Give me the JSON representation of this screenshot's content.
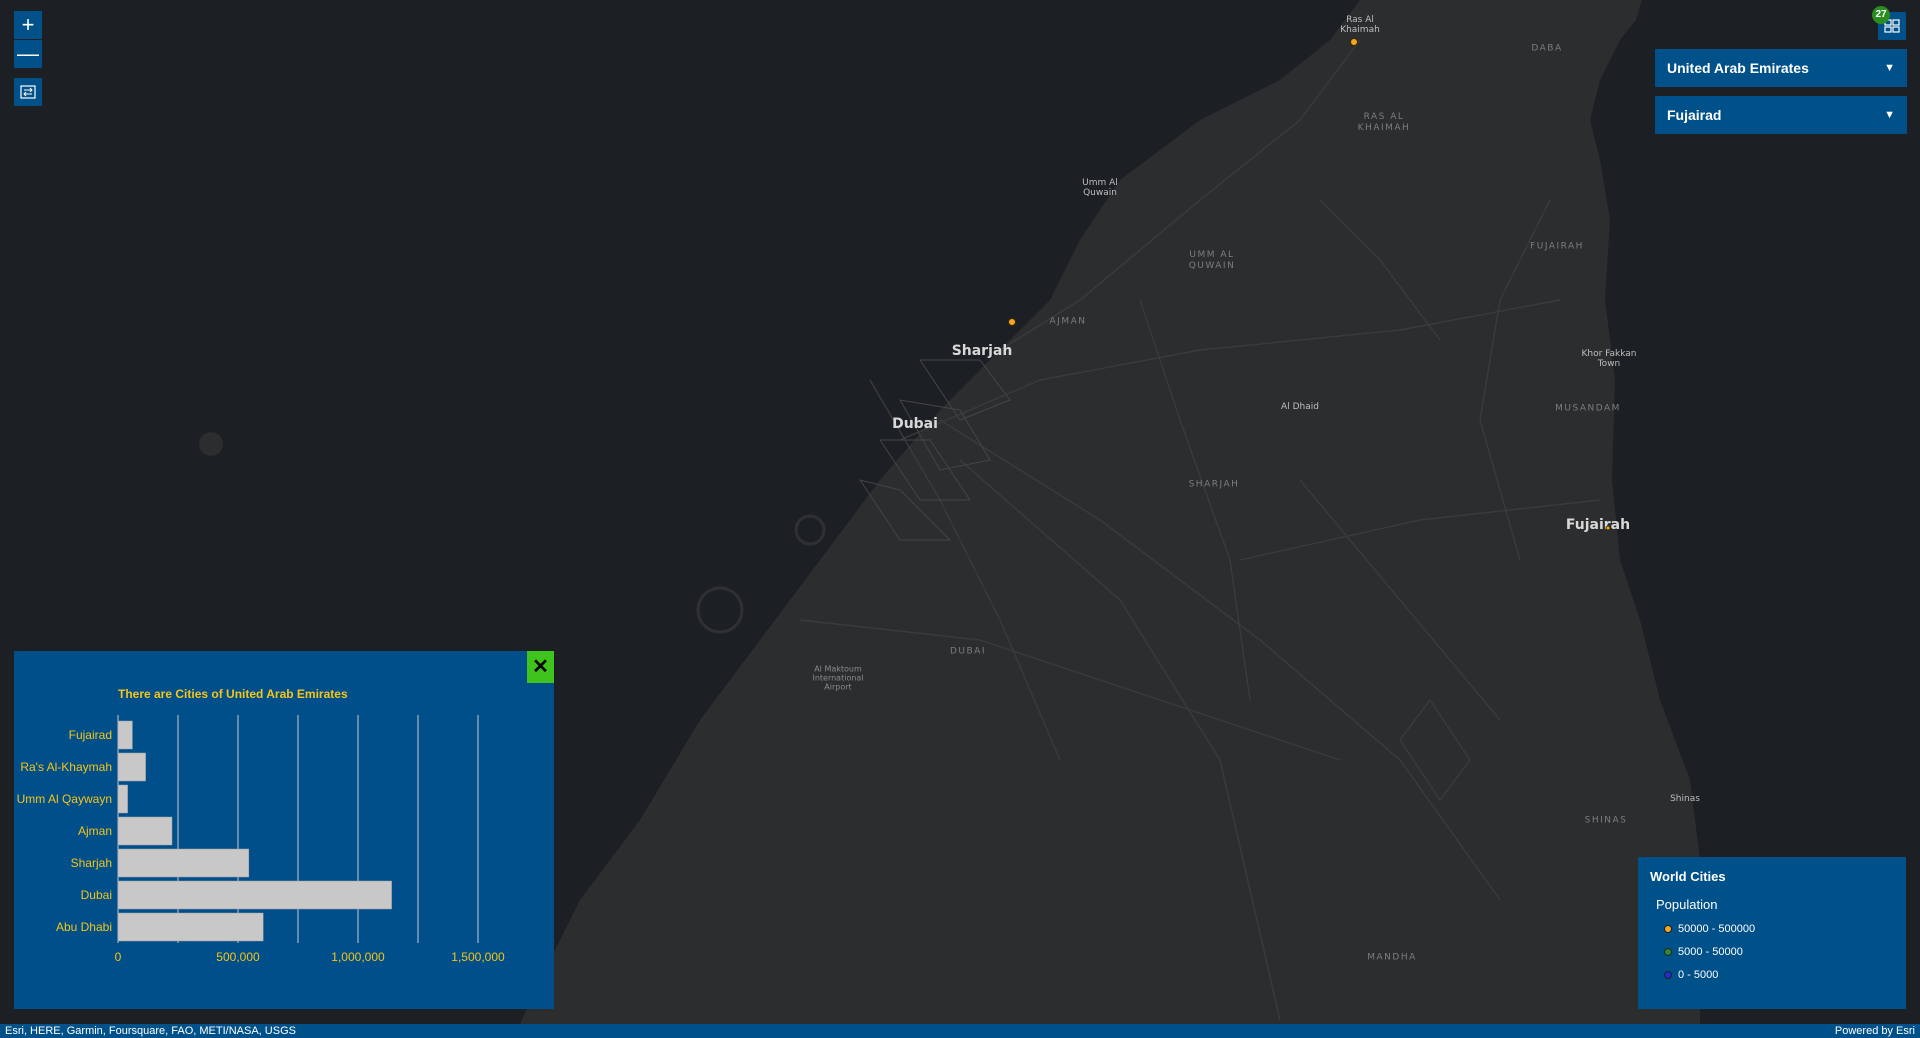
{
  "map": {
    "cities": [
      {
        "name": "Sharjah"
      },
      {
        "name": "Dubai"
      },
      {
        "name": "Fujairah"
      }
    ],
    "regions": [
      "RAS AL KHAIMAH",
      "UMM AL QUWAIN",
      "AJMAN",
      "SHARJAH",
      "DUBAI",
      "FUJAIRAH",
      "MUSANDAM",
      "SHINAS",
      "MANDHA",
      "DABA"
    ],
    "small_places": [
      "Ras Al Khaimah",
      "Umm Al Quwain",
      "Khor Fakkan Town",
      "Al Dhaid",
      "Al Maktoum International Airport",
      "Shinas"
    ]
  },
  "controls": {
    "zoom_in": "+",
    "zoom_out": "—",
    "layers_badge": "27"
  },
  "selects": {
    "country": "United Arab Emirates",
    "city": "Fujairad"
  },
  "chart_panel": {
    "close_label": "✕"
  },
  "chart_data": {
    "type": "bar",
    "orientation": "horizontal",
    "title": "There are Cities of United Arab Emirates",
    "categories": [
      "Fujairad",
      "Ra's Al-Khaymah",
      "Umm Al Qaywayn",
      "Ajman",
      "Sharjah",
      "Dubai",
      "Abu Dhabi"
    ],
    "values": [
      60000,
      115000,
      40000,
      225000,
      545000,
      1140000,
      605000
    ],
    "xticks": [
      0,
      500000,
      1000000,
      1500000
    ],
    "xtick_labels": [
      "0",
      "500,000",
      "1,000,000",
      "1,500,000"
    ],
    "xlim": [
      0,
      1500000
    ],
    "colors": {
      "bar": "#c8c8c8",
      "text": "#f5c518",
      "grid": "#c8c8c8"
    }
  },
  "legend": {
    "title": "World Cities",
    "subtitle": "Population",
    "items": [
      {
        "label": "50000 - 500000",
        "color": "#f5a623"
      },
      {
        "label": "5000 - 50000",
        "color": "#2e8b2e"
      },
      {
        "label": "0 - 5000",
        "color": "#1f2fcf"
      }
    ]
  },
  "attribution": {
    "sources": "Esri, HERE, Garmin, Foursquare, FAO, METI/NASA, USGS",
    "powered": "Powered by Esri"
  }
}
